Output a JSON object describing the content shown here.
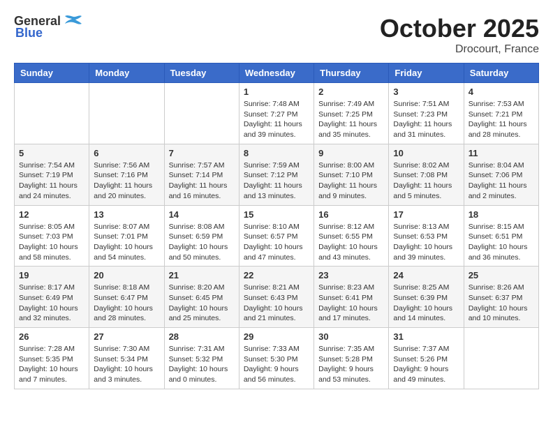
{
  "header": {
    "logo_general": "General",
    "logo_blue": "Blue",
    "month": "October 2025",
    "location": "Drocourt, France"
  },
  "weekdays": [
    "Sunday",
    "Monday",
    "Tuesday",
    "Wednesday",
    "Thursday",
    "Friday",
    "Saturday"
  ],
  "weeks": [
    [
      {
        "day": "",
        "info": ""
      },
      {
        "day": "",
        "info": ""
      },
      {
        "day": "",
        "info": ""
      },
      {
        "day": "1",
        "info": "Sunrise: 7:48 AM\nSunset: 7:27 PM\nDaylight: 11 hours\nand 39 minutes."
      },
      {
        "day": "2",
        "info": "Sunrise: 7:49 AM\nSunset: 7:25 PM\nDaylight: 11 hours\nand 35 minutes."
      },
      {
        "day": "3",
        "info": "Sunrise: 7:51 AM\nSunset: 7:23 PM\nDaylight: 11 hours\nand 31 minutes."
      },
      {
        "day": "4",
        "info": "Sunrise: 7:53 AM\nSunset: 7:21 PM\nDaylight: 11 hours\nand 28 minutes."
      }
    ],
    [
      {
        "day": "5",
        "info": "Sunrise: 7:54 AM\nSunset: 7:19 PM\nDaylight: 11 hours\nand 24 minutes."
      },
      {
        "day": "6",
        "info": "Sunrise: 7:56 AM\nSunset: 7:16 PM\nDaylight: 11 hours\nand 20 minutes."
      },
      {
        "day": "7",
        "info": "Sunrise: 7:57 AM\nSunset: 7:14 PM\nDaylight: 11 hours\nand 16 minutes."
      },
      {
        "day": "8",
        "info": "Sunrise: 7:59 AM\nSunset: 7:12 PM\nDaylight: 11 hours\nand 13 minutes."
      },
      {
        "day": "9",
        "info": "Sunrise: 8:00 AM\nSunset: 7:10 PM\nDaylight: 11 hours\nand 9 minutes."
      },
      {
        "day": "10",
        "info": "Sunrise: 8:02 AM\nSunset: 7:08 PM\nDaylight: 11 hours\nand 5 minutes."
      },
      {
        "day": "11",
        "info": "Sunrise: 8:04 AM\nSunset: 7:06 PM\nDaylight: 11 hours\nand 2 minutes."
      }
    ],
    [
      {
        "day": "12",
        "info": "Sunrise: 8:05 AM\nSunset: 7:03 PM\nDaylight: 10 hours\nand 58 minutes."
      },
      {
        "day": "13",
        "info": "Sunrise: 8:07 AM\nSunset: 7:01 PM\nDaylight: 10 hours\nand 54 minutes."
      },
      {
        "day": "14",
        "info": "Sunrise: 8:08 AM\nSunset: 6:59 PM\nDaylight: 10 hours\nand 50 minutes."
      },
      {
        "day": "15",
        "info": "Sunrise: 8:10 AM\nSunset: 6:57 PM\nDaylight: 10 hours\nand 47 minutes."
      },
      {
        "day": "16",
        "info": "Sunrise: 8:12 AM\nSunset: 6:55 PM\nDaylight: 10 hours\nand 43 minutes."
      },
      {
        "day": "17",
        "info": "Sunrise: 8:13 AM\nSunset: 6:53 PM\nDaylight: 10 hours\nand 39 minutes."
      },
      {
        "day": "18",
        "info": "Sunrise: 8:15 AM\nSunset: 6:51 PM\nDaylight: 10 hours\nand 36 minutes."
      }
    ],
    [
      {
        "day": "19",
        "info": "Sunrise: 8:17 AM\nSunset: 6:49 PM\nDaylight: 10 hours\nand 32 minutes."
      },
      {
        "day": "20",
        "info": "Sunrise: 8:18 AM\nSunset: 6:47 PM\nDaylight: 10 hours\nand 28 minutes."
      },
      {
        "day": "21",
        "info": "Sunrise: 8:20 AM\nSunset: 6:45 PM\nDaylight: 10 hours\nand 25 minutes."
      },
      {
        "day": "22",
        "info": "Sunrise: 8:21 AM\nSunset: 6:43 PM\nDaylight: 10 hours\nand 21 minutes."
      },
      {
        "day": "23",
        "info": "Sunrise: 8:23 AM\nSunset: 6:41 PM\nDaylight: 10 hours\nand 17 minutes."
      },
      {
        "day": "24",
        "info": "Sunrise: 8:25 AM\nSunset: 6:39 PM\nDaylight: 10 hours\nand 14 minutes."
      },
      {
        "day": "25",
        "info": "Sunrise: 8:26 AM\nSunset: 6:37 PM\nDaylight: 10 hours\nand 10 minutes."
      }
    ],
    [
      {
        "day": "26",
        "info": "Sunrise: 7:28 AM\nSunset: 5:35 PM\nDaylight: 10 hours\nand 7 minutes."
      },
      {
        "day": "27",
        "info": "Sunrise: 7:30 AM\nSunset: 5:34 PM\nDaylight: 10 hours\nand 3 minutes."
      },
      {
        "day": "28",
        "info": "Sunrise: 7:31 AM\nSunset: 5:32 PM\nDaylight: 10 hours\nand 0 minutes."
      },
      {
        "day": "29",
        "info": "Sunrise: 7:33 AM\nSunset: 5:30 PM\nDaylight: 9 hours\nand 56 minutes."
      },
      {
        "day": "30",
        "info": "Sunrise: 7:35 AM\nSunset: 5:28 PM\nDaylight: 9 hours\nand 53 minutes."
      },
      {
        "day": "31",
        "info": "Sunrise: 7:37 AM\nSunset: 5:26 PM\nDaylight: 9 hours\nand 49 minutes."
      },
      {
        "day": "",
        "info": ""
      }
    ]
  ]
}
